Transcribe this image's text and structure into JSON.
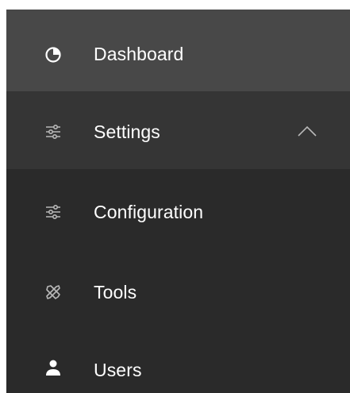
{
  "colors": {
    "sidebar_bg": "#2a2a2a",
    "active_bg": "#484848",
    "expanded_bg": "#353535",
    "text": "#ffffff",
    "icon_muted": "#b8b8b8"
  },
  "nav": {
    "items": [
      {
        "label": "Dashboard",
        "icon": "pie-chart-icon",
        "state": "active"
      },
      {
        "label": "Settings",
        "icon": "sliders-icon",
        "state": "expanded",
        "chevron": "chevron-up-icon"
      },
      {
        "label": "Configuration",
        "icon": "sliders-icon",
        "state": "child"
      },
      {
        "label": "Tools",
        "icon": "tools-icon",
        "state": "child"
      },
      {
        "label": "Users",
        "icon": "user-icon",
        "state": "default"
      }
    ]
  }
}
